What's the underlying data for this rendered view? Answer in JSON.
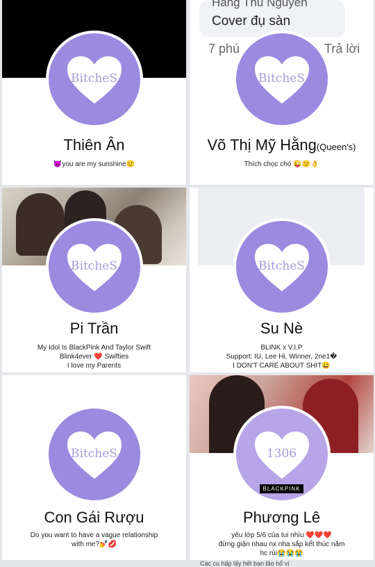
{
  "avatar_text": "BitcheS",
  "top_right_comment": {
    "author": "Hằng Thu Nguyễn",
    "text": "Cover đụ sàn",
    "time": "7 phú",
    "reply_label": "Trả lời"
  },
  "cards": [
    {
      "name": "Thiên Ân",
      "bio_line1": "😈you are my sunshine🙂"
    },
    {
      "name": "Võ Thị Mỹ Hằng",
      "name_suffix": "(Queen's)",
      "bio_line1": "Thích chọc chó 😜🙂👌"
    },
    {
      "name": "Pi Trần",
      "bio_line1": "My Idol Is BlackPink And Taylor Swift",
      "bio_line2": "Blink4ever ❤️ Swifties",
      "bio_line3": "I love my Parents"
    },
    {
      "name": "Su Nè",
      "bio_line1": "BLINK x V.I.P",
      "bio_line2": "Support: IU, Lee Hi, Winner, 2ne1�",
      "bio_line3": "I DON'T CARE ABOUT SHIT😀"
    },
    {
      "name": "Con Gái Rượu",
      "bio_line1": "Do you want to have a vague relationship",
      "bio_line2": "with me?💅💋"
    },
    {
      "name": "Phương Lê",
      "avatar_text": "1306",
      "brand": "BLACKPINK",
      "bio_line1": "yêu lớp 5/6 của tui nhìu ❤️❤️❤️",
      "bio_line2": "đừng giận nhau nx nha sắp kết thúc năm",
      "bio_line3": "hc rùi😭😭😭"
    }
  ],
  "stray_text": "Các cu hấp lấy hết bạn lão hổ ví"
}
